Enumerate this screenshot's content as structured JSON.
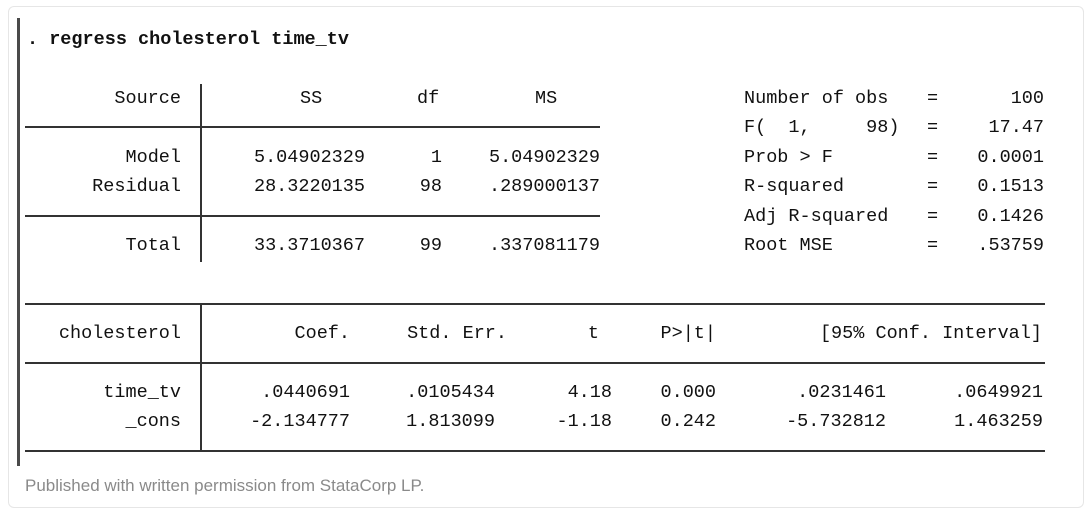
{
  "command": ". regress cholesterol time_tv",
  "anova": {
    "headers": {
      "source": "Source",
      "ss": "SS",
      "df": "df",
      "ms": "MS"
    },
    "rows": [
      {
        "source": "Model",
        "ss": "5.04902329",
        "df": "1",
        "ms": "5.04902329"
      },
      {
        "source": "Residual",
        "ss": "28.3220135",
        "df": "98",
        "ms": ".289000137"
      }
    ],
    "total": {
      "source": "Total",
      "ss": "33.3710367",
      "df": "99",
      "ms": ".337081179"
    }
  },
  "stats": [
    {
      "label": "Number of obs",
      "eq": "=",
      "value": "100"
    },
    {
      "label": "F(  1,     98)",
      "eq": "=",
      "value": "17.47"
    },
    {
      "label": "Prob > F",
      "eq": "=",
      "value": "0.0001"
    },
    {
      "label": "R-squared",
      "eq": "=",
      "value": "0.1513"
    },
    {
      "label": "Adj R-squared",
      "eq": "=",
      "value": "0.1426"
    },
    {
      "label": "Root MSE",
      "eq": "=",
      "value": ".53759"
    }
  ],
  "coef_table": {
    "headers": {
      "var": "cholesterol",
      "coef": "Coef.",
      "se": "Std. Err.",
      "t": "t",
      "p": "P>|t|",
      "ci": "[95% Conf. Interval]"
    },
    "rows": [
      {
        "var": "time_tv",
        "coef": ".0440691",
        "se": ".0105434",
        "t": "4.18",
        "p": "0.000",
        "lo": ".0231461",
        "hi": ".0649921"
      },
      {
        "var": "_cons",
        "coef": "-2.134777",
        "se": "1.813099",
        "t": "-1.18",
        "p": "0.242",
        "lo": "-5.732812",
        "hi": "1.463259"
      }
    ]
  },
  "caption": "Published with written permission from StataCorp LP."
}
